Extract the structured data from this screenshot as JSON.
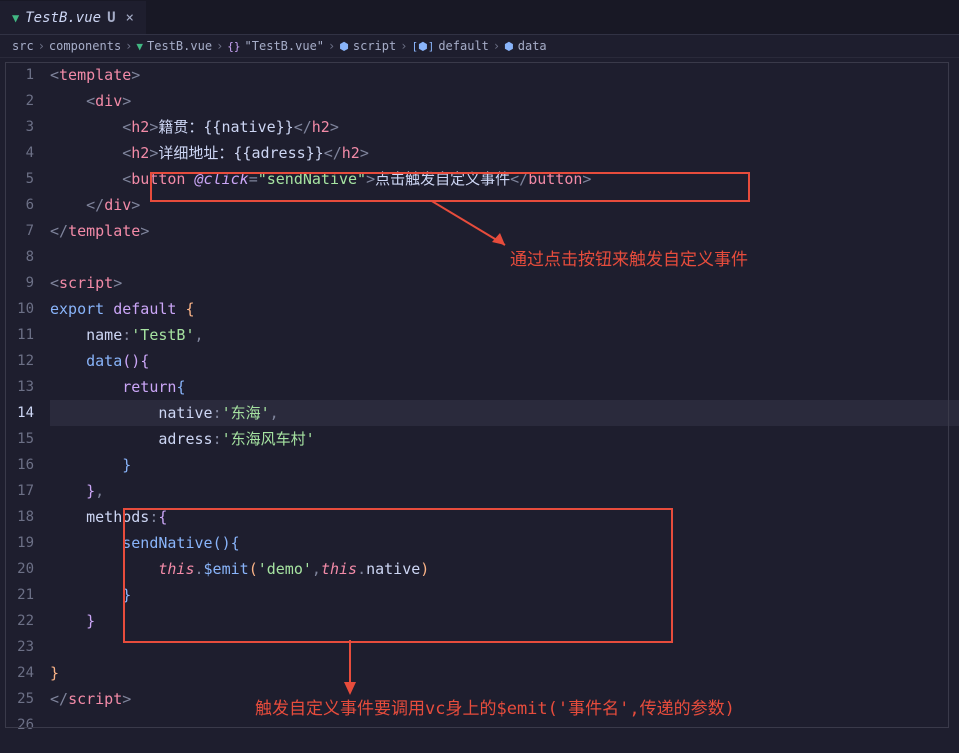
{
  "tab": {
    "filename": "TestB.vue",
    "modified_indicator": "U"
  },
  "breadcrumbs": {
    "items": [
      {
        "label": "src",
        "icon": ""
      },
      {
        "label": "components",
        "icon": ""
      },
      {
        "label": "TestB.vue",
        "icon": "vue"
      },
      {
        "label": "\"TestB.vue\"",
        "icon": "braces"
      },
      {
        "label": "script",
        "icon": "cube"
      },
      {
        "label": "default",
        "icon": "cube-var"
      },
      {
        "label": "data",
        "icon": "cube"
      }
    ]
  },
  "line_numbers": [
    "1",
    "2",
    "3",
    "4",
    "5",
    "6",
    "7",
    "8",
    "9",
    "10",
    "11",
    "12",
    "13",
    "14",
    "15",
    "16",
    "17",
    "18",
    "19",
    "20",
    "21",
    "22",
    "23",
    "24",
    "25",
    "26"
  ],
  "current_line": 14,
  "code": {
    "line1_tag": "template",
    "line2_tag": "div",
    "line3_tag": "h2",
    "line3_text": "籍贯：",
    "line3_var": "{{native}}",
    "line4_tag": "h2",
    "line4_text": "详细地址：",
    "line4_var": "{{adress}}",
    "line5_tag": "button",
    "line5_attr": "@click",
    "line5_val": "\"sendNative\"",
    "line5_text": "点击触发自定义事件",
    "line9_tag": "script",
    "line10_export": "export",
    "line10_default": "default",
    "line11_name": "name",
    "line11_val": "'TestB'",
    "line12_data": "data",
    "line13_return": "return",
    "line14_native": "native",
    "line14_val": "'东海'",
    "line15_adress": "adress",
    "line15_val": "'东海风车村'",
    "line18_methods": "methods",
    "line19_func": "sendNative",
    "line20_this": "this",
    "line20_emit": "$emit",
    "line20_demo": "'demo'",
    "line20_native": "native"
  },
  "annotations": {
    "text1": "通过点击按钮来触发自定义事件",
    "text2": "触发自定义事件要调用vc身上的$emit('事件名',传递的参数)"
  }
}
